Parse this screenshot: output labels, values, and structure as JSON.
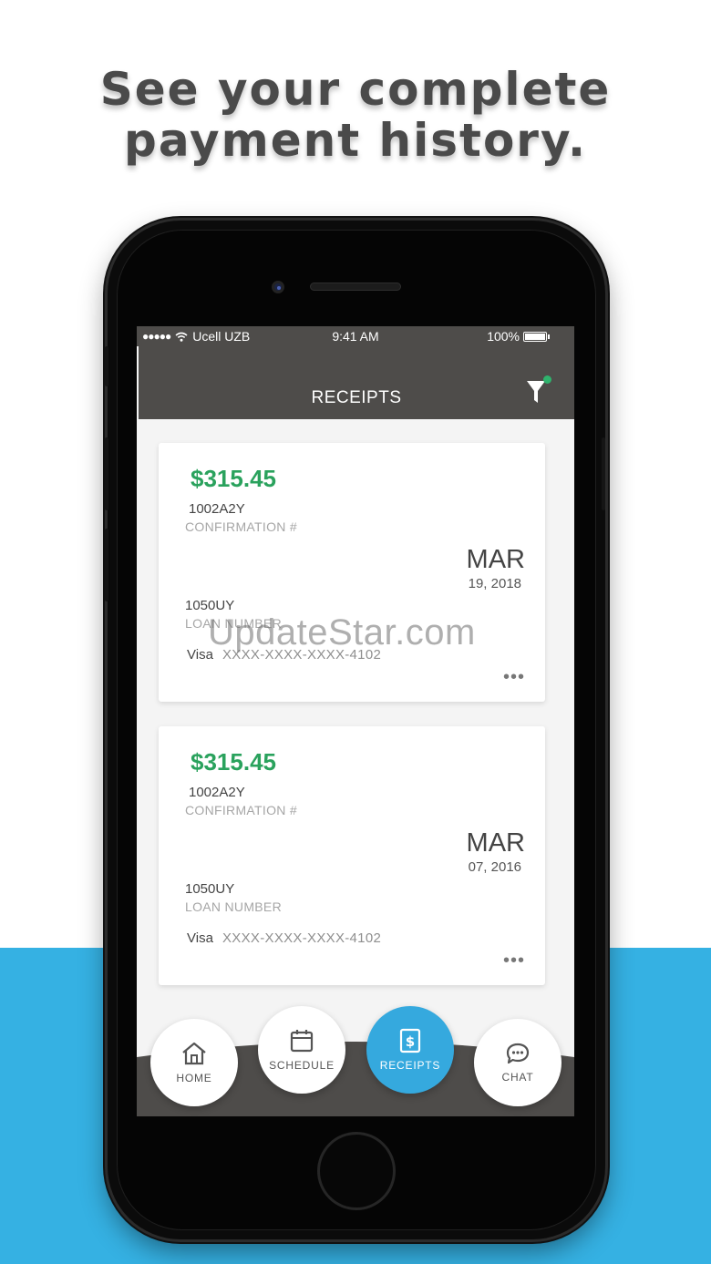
{
  "headline": {
    "line1": "See your complete",
    "line2": "payment history."
  },
  "status_bar": {
    "signal": "●●●●●",
    "carrier": "Ucell UZB",
    "time": "9:41 AM",
    "battery": "100%"
  },
  "header": {
    "title": "RECEIPTS"
  },
  "receipts": [
    {
      "amount": "$315.45",
      "confirmation": "1002A2Y",
      "confirmation_label": "CONFIRMATION #",
      "month": "MAR",
      "day_year": "19, 2018",
      "loan": "1050UY",
      "loan_label": "LOAN NUMBER",
      "card_brand": "Visa",
      "card_number": "XXXX-XXXX-XXXX-4102",
      "more": "•••"
    },
    {
      "amount": "$315.45",
      "confirmation": "1002A2Y",
      "confirmation_label": "CONFIRMATION #",
      "month": "MAR",
      "day_year": "07, 2016",
      "loan": "1050UY",
      "loan_label": "LOAN NUMBER",
      "card_brand": "Visa",
      "card_number": "XXXX-XXXX-XXXX-4102",
      "more": "•••"
    }
  ],
  "watermark": "UpdateStar.com",
  "nav": [
    {
      "label": "HOME",
      "icon": "home-icon"
    },
    {
      "label": "SCHEDULE",
      "icon": "calendar-icon"
    },
    {
      "label": "RECEIPTS",
      "icon": "receipt-dollar-icon",
      "active": true
    },
    {
      "label": "CHAT",
      "icon": "chat-bubble-icon"
    }
  ],
  "colors": {
    "accent_blue": "#35b1e3",
    "amount_green": "#2aa25d",
    "header_gray": "#4e4c4a",
    "filter_dot": "#2fb36d"
  }
}
